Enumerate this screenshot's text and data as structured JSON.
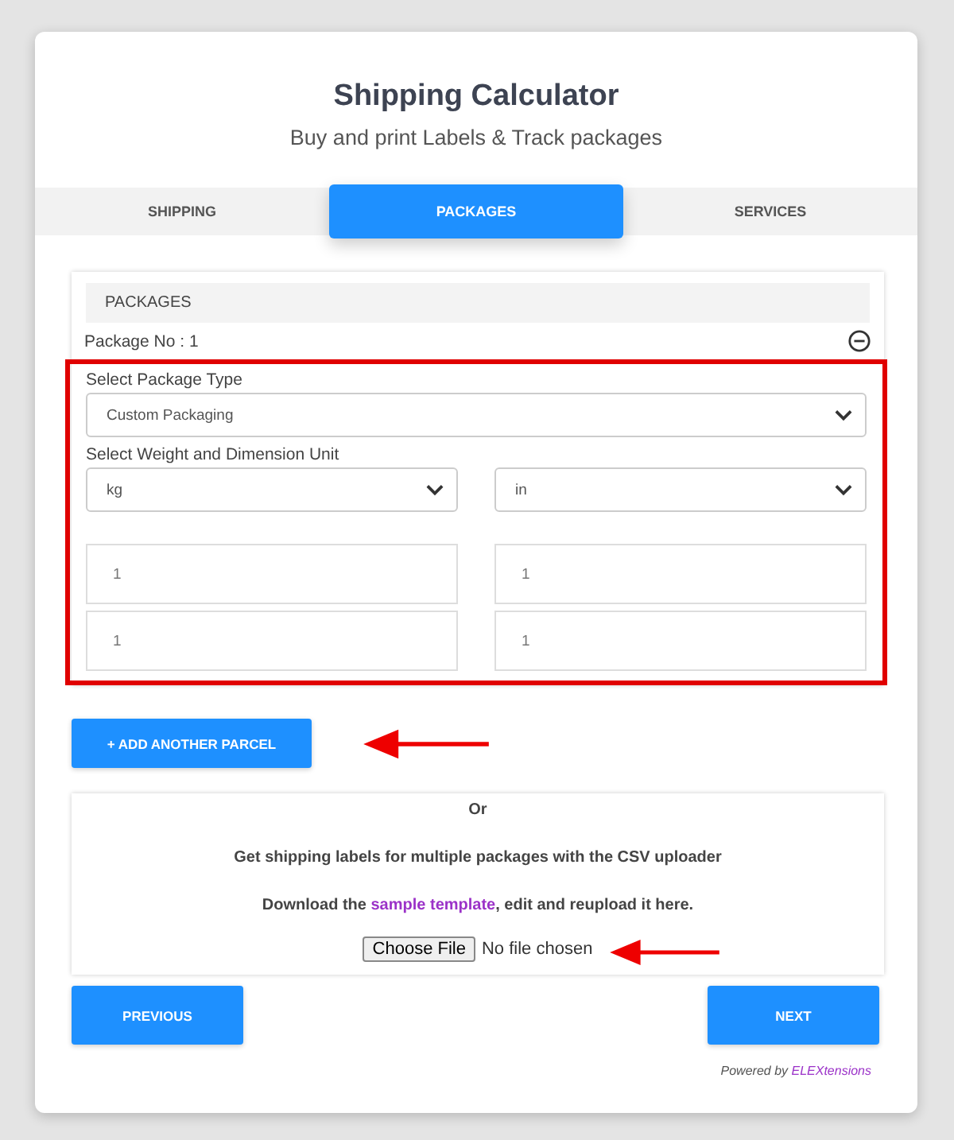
{
  "header": {
    "title": "Shipping Calculator",
    "subtitle": "Buy and print Labels & Track packages"
  },
  "tabs": [
    {
      "label": "SHIPPING",
      "selected": false
    },
    {
      "label": "PACKAGES",
      "selected": true
    },
    {
      "label": "SERVICES",
      "selected": false
    }
  ],
  "packages_panel": {
    "heading": "PACKAGES",
    "package_label": "Package No : 1",
    "package_type": {
      "label": "Select Package Type",
      "value": "Custom Packaging"
    },
    "unit": {
      "label": "Select Weight and Dimension Unit",
      "weight": "kg",
      "dimension": "in"
    },
    "inputs": [
      {
        "value": "1"
      },
      {
        "value": "1"
      },
      {
        "value": "1"
      },
      {
        "value": "1"
      }
    ]
  },
  "add_button": "+ ADD ANOTHER PARCEL",
  "csv_panel": {
    "or": "Or",
    "description": "Get shipping labels for multiple packages with the CSV uploader",
    "download": {
      "before": "Download the ",
      "link": "sample template",
      "after": ", edit and reupload it here."
    },
    "file_button": "Choose File",
    "file_status": "No file chosen"
  },
  "buttons": {
    "previous": "PREVIOUS",
    "next": "NEXT"
  },
  "footer": {
    "text": "Powered by ",
    "link": "ELEXtensions"
  }
}
